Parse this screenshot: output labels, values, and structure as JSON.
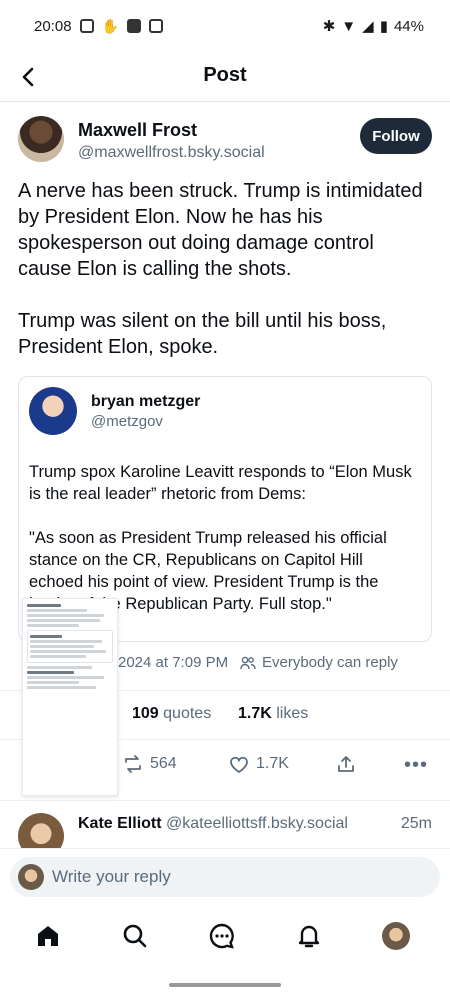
{
  "status_bar": {
    "time": "20:08",
    "battery": "44%"
  },
  "nav": {
    "title": "Post",
    "back_icon": "back-arrow-icon"
  },
  "post": {
    "author_name": "Maxwell Frost",
    "author_handle": "@maxwellfrost.bsky.social",
    "follow_label": "Follow",
    "text": "A nerve has been struck. Trump is intimidated by President Elon. Now he has his spokesperson out doing damage control cause Elon is calling the shots.\n\nTrump was silent on the bill until his boss, President Elon, spoke."
  },
  "quote": {
    "author_name": "bryan metzger",
    "author_handle": "@metzgov",
    "text": "Trump spox Karoline Leavitt responds to “Elon Musk is the real leader” rhetoric from Dems:\n\n\"As soon as President Trump released his official stance on the CR, Republicans on Capitol Hill echoed his point of view. President Trump is the leader of the Republican Party. Full stop.\""
  },
  "meta": {
    "time_text": "2024 at 7:09 PM",
    "reply_setting": "Everybody can reply"
  },
  "stats": {
    "quotes_count": "109",
    "quotes_label": "quotes",
    "likes_count": "1.7K",
    "likes_label": "likes"
  },
  "actions": {
    "reposts": "564",
    "likes": "1.7K"
  },
  "reply_preview": {
    "name": "Kate Elliott",
    "handle": "@kateelliottsff.bsky.social",
    "time": "25m"
  },
  "reply_input": {
    "placeholder": "Write your reply"
  },
  "tabs": [
    "home-icon",
    "search-icon",
    "chat-icon",
    "notifications-icon",
    "profile-avatar"
  ],
  "colors": {
    "follow_bg": "#1e2a38",
    "secondary_text": "#5a6b7b"
  }
}
